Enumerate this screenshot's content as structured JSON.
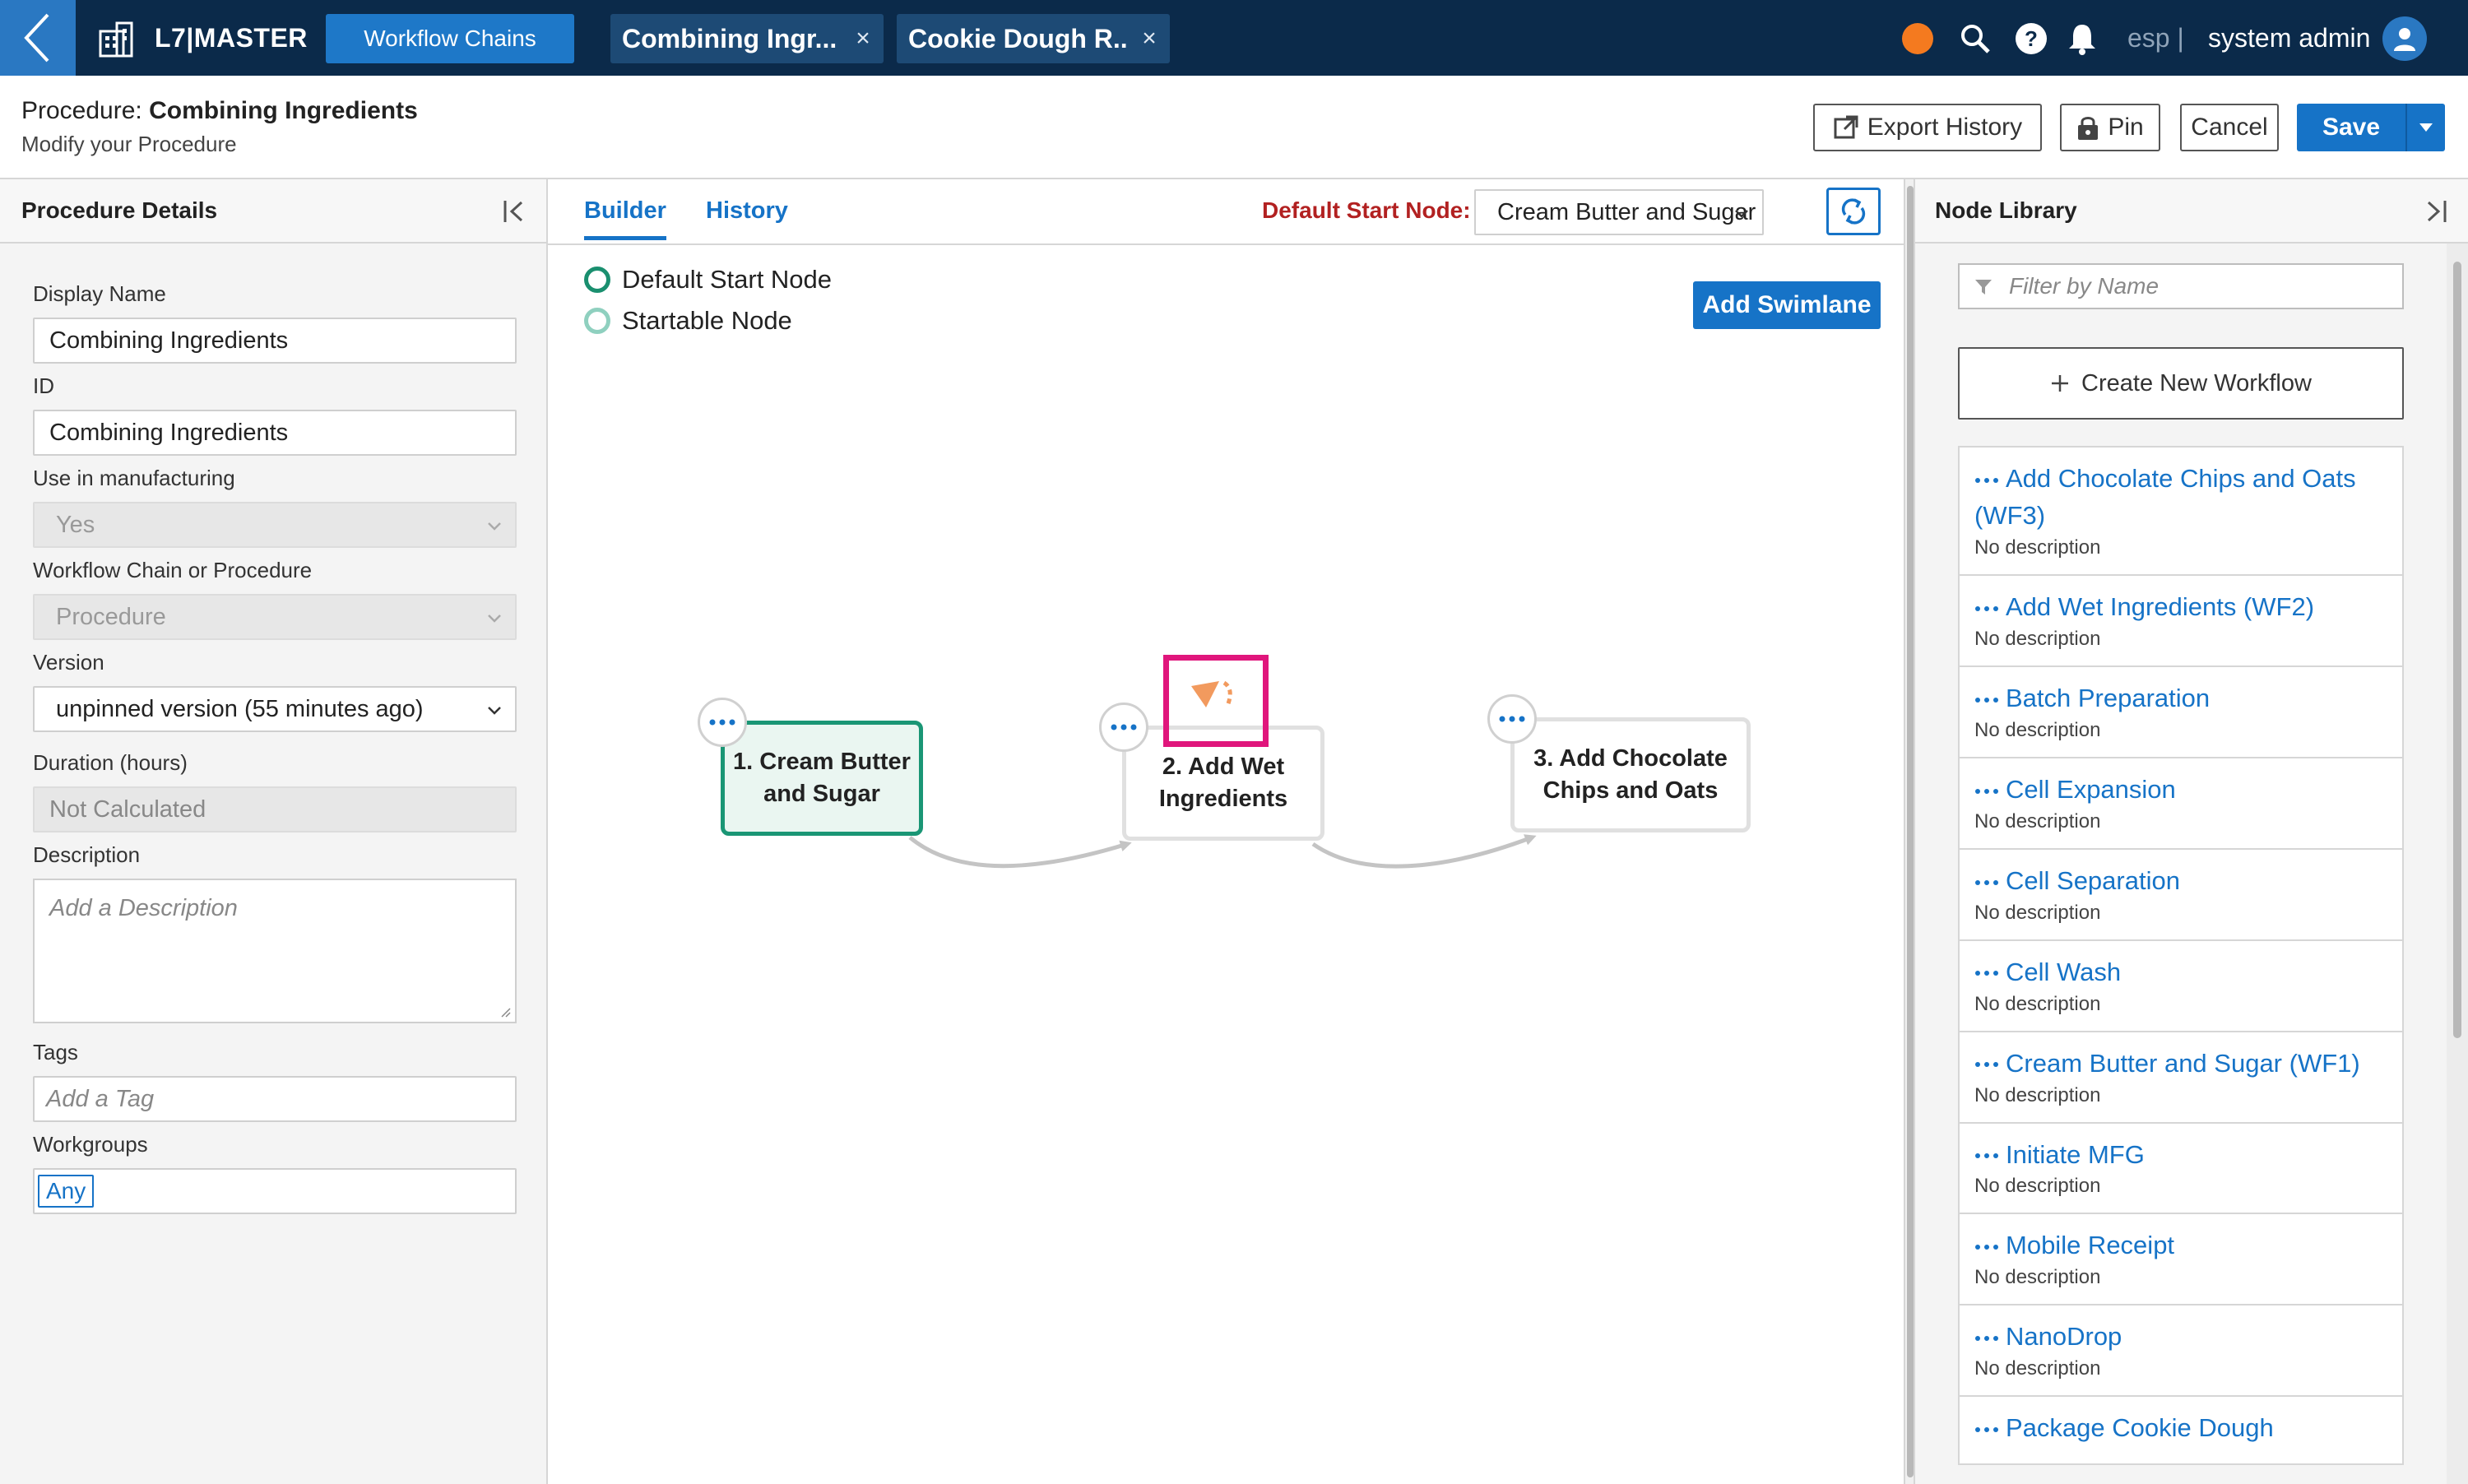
{
  "app": {
    "name": "L7|MASTER",
    "nav_pill": "Workflow Chains",
    "open_tabs": [
      {
        "label": "Combining Ingr..."
      },
      {
        "label": "Cookie Dough R..."
      }
    ],
    "close_glyph": "×",
    "lang": "esp |",
    "user": "system admin",
    "colors": {
      "topbar": "#0b2a4a",
      "accent": "#1673c7",
      "status_dot": "#f47a1f",
      "start_node": "#1a9675",
      "highlight": "#e0167c",
      "warning_label": "#b22121"
    }
  },
  "header": {
    "title_prefix": "Procedure:",
    "title_name": "Combining Ingredients",
    "subtitle": "Modify your Procedure",
    "export_label": "Export History",
    "pin_label": "Pin",
    "cancel_label": "Cancel",
    "save_label": "Save"
  },
  "details": {
    "panel_title": "Procedure Details",
    "display_name_label": "Display Name",
    "display_name_value": "Combining Ingredients",
    "id_label": "ID",
    "id_value": "Combining Ingredients",
    "manufacturing_label": "Use in manufacturing",
    "manufacturing_value": "Yes",
    "chain_label": "Workflow Chain or Procedure",
    "chain_value": "Procedure",
    "version_label": "Version",
    "version_value": "unpinned version (55 minutes ago)",
    "duration_label": "Duration (hours)",
    "duration_value": "Not Calculated",
    "description_label": "Description",
    "description_placeholder": "Add a Description",
    "tags_label": "Tags",
    "tags_placeholder": "Add a Tag",
    "workgroups_label": "Workgroups",
    "workgroups_chip": "Any"
  },
  "builder": {
    "tab_builder": "Builder",
    "tab_history": "History",
    "default_start_label": "Default Start Node:",
    "default_start_value": "Cream Butter and Sugar",
    "legend_default": "Default Start Node",
    "legend_startable": "Startable Node",
    "add_swimlane": "Add Swimlane",
    "nodes": [
      {
        "line1": "1. Cream Butter",
        "line2": "and Sugar"
      },
      {
        "line1": "2. Add Wet",
        "line2": "Ingredients"
      },
      {
        "line1": "3. Add Chocolate",
        "line2": "Chips and Oats"
      }
    ]
  },
  "library": {
    "panel_title": "Node Library",
    "filter_placeholder": "Filter by Name",
    "create_label": "Create New Workflow",
    "items": [
      {
        "name": "Add Chocolate Chips and Oats (WF3)",
        "desc": "No description"
      },
      {
        "name": "Add Wet Ingredients (WF2)",
        "desc": "No description"
      },
      {
        "name": "Batch Preparation",
        "desc": "No description"
      },
      {
        "name": "Cell Expansion",
        "desc": "No description"
      },
      {
        "name": "Cell Separation",
        "desc": "No description"
      },
      {
        "name": "Cell Wash",
        "desc": "No description"
      },
      {
        "name": "Cream Butter and Sugar (WF1)",
        "desc": "No description"
      },
      {
        "name": "Initiate MFG",
        "desc": "No description"
      },
      {
        "name": "Mobile Receipt",
        "desc": "No description"
      },
      {
        "name": "NanoDrop",
        "desc": "No description"
      },
      {
        "name": "Package Cookie Dough",
        "desc": ""
      }
    ]
  }
}
